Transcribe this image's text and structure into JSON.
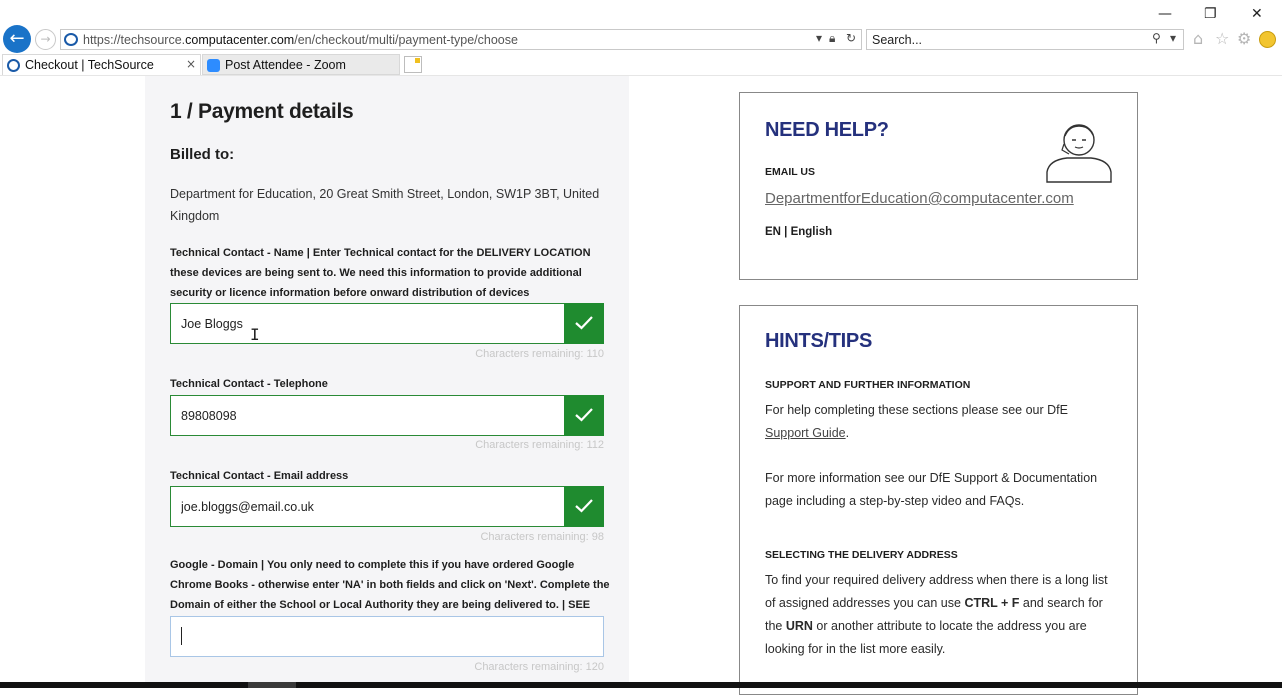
{
  "browser": {
    "window_controls": {
      "minimize": "—",
      "restore": "❐",
      "close": "✕"
    },
    "back_icon": "←",
    "forward_icon": "→",
    "url_prefix": "https://techsource.",
    "url_domain": "computacenter.com",
    "url_path": "/en/checkout/multi/payment-type/choose",
    "search_placeholder": "Search...",
    "tabs": [
      {
        "title": "Checkout | TechSource",
        "close": "×"
      },
      {
        "title": "Post Attendee - Zoom"
      }
    ],
    "icons": [
      "dropdown-icon",
      "lock-icon",
      "refresh-icon",
      "search-icon",
      "home-icon",
      "favorites-star-icon",
      "settings-gear-icon",
      "smiley-feedback-icon"
    ]
  },
  "payment": {
    "title": "1 / Payment details",
    "billed_label": "Billed to:",
    "billed_address": "Department for Education, 20 Great Smith Street, London, SW1P 3BT, United Kingdom",
    "fields": [
      {
        "label": "Technical Contact - Name | Enter Technical contact for the DELIVERY LOCATION these devices are being sent to. We need this information to provide additional security or licence information before onward distribution of devices",
        "value": "Joe Bloggs",
        "remaining": "Characters remaining: 110",
        "valid": true
      },
      {
        "label": "Technical Contact - Telephone",
        "value": "89808098",
        "remaining": "Characters remaining: 112",
        "valid": true
      },
      {
        "label": "Technical Contact - Email address",
        "value": "joe.bloggs@email.co.uk",
        "remaining": "Characters remaining: 98",
        "valid": true
      },
      {
        "label": "Google - Domain | You only need to complete this if you have ordered Google Chrome Books - otherwise enter 'NA' in both fields and click on 'Next'. Complete the Domain of either the School or Local Authority they are being delivered to. | SEE HINTS/TIPS",
        "value": "",
        "remaining": "Characters remaining: 120",
        "valid": false
      }
    ]
  },
  "help": {
    "title": "NEED HELP?",
    "email_label": "EMAIL US",
    "email": "DepartmentforEducation@computacenter.com",
    "language": "EN | English"
  },
  "hints": {
    "title": "HINTS/TIPS",
    "section1_heading": "SUPPORT AND FURTHER INFORMATION",
    "section1_text": "For help completing these sections please see our DfE ",
    "section1_link": "Support Guide",
    "section1_end": ".",
    "section2_text": "For more information see our DfE Support & Documentation page including a step-by-step video and FAQs.",
    "section3_heading": "SELECTING THE DELIVERY ADDRESS",
    "section3_part1": "To find your required delivery address when there is a long list of assigned addresses you can use ",
    "section3_key": "CTRL + F",
    "section3_part2": " and search for the ",
    "section3_urn": "URN",
    "section3_part3": " or another attribute to locate the address you are looking for in the list more easily."
  },
  "colors": {
    "accent_green": "#1f8b2f",
    "title_navy": "#25317d",
    "browser_blue": "#1a73c8"
  }
}
